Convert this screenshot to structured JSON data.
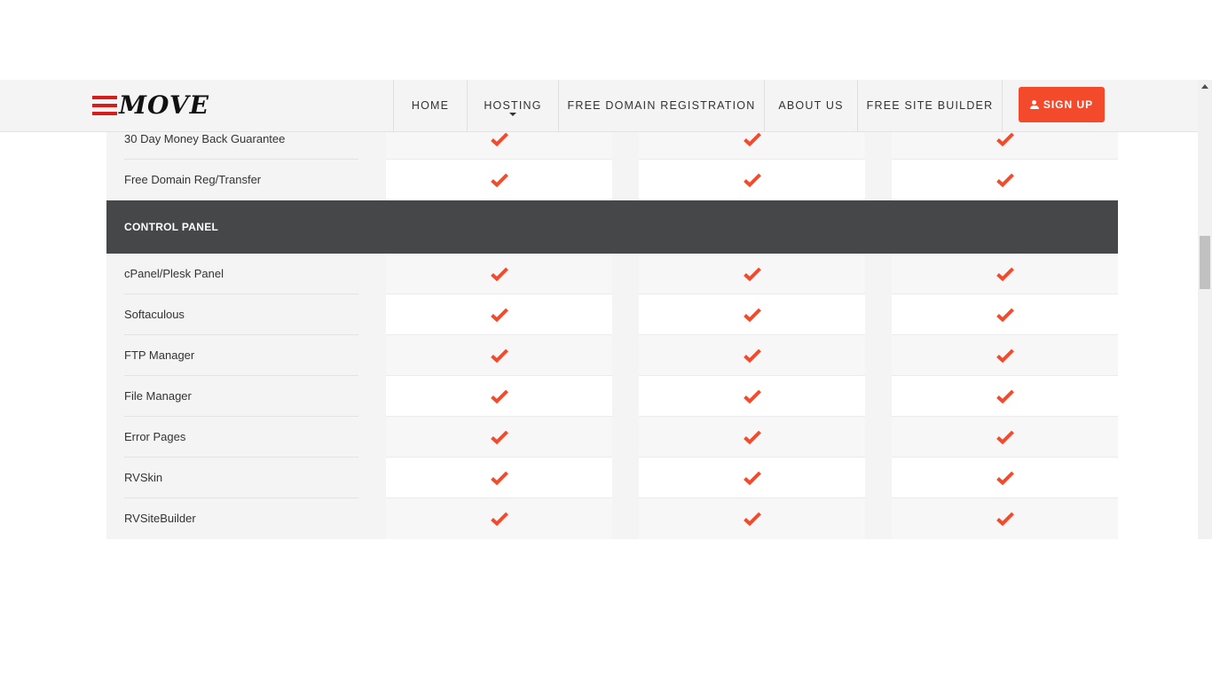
{
  "header": {
    "logo_text": "MOVE",
    "nav": [
      {
        "label": "HOME",
        "has_dropdown": false
      },
      {
        "label": "HOSTING",
        "has_dropdown": true
      },
      {
        "label": "FREE DOMAIN REGISTRATION",
        "has_dropdown": false
      },
      {
        "label": "ABOUT US",
        "has_dropdown": false
      },
      {
        "label": "FREE SITE BUILDER",
        "has_dropdown": false
      }
    ],
    "signup_label": "SIGN UP",
    "signup_icon": "user-icon"
  },
  "colors": {
    "accent": "#f44a2c",
    "logo_red": "#d81b1b",
    "section_header_bg": "#454749",
    "check": "#f44a2c"
  },
  "table": {
    "rows_top": [
      {
        "label": "30 Day Money Back Guarantee",
        "plans": [
          true,
          true,
          true
        ]
      },
      {
        "label": "Free Domain Reg/Transfer",
        "plans": [
          true,
          true,
          true
        ]
      }
    ],
    "section": {
      "title": "CONTROL PANEL",
      "rows": [
        {
          "label": "cPanel/Plesk Panel",
          "plans": [
            true,
            true,
            true
          ]
        },
        {
          "label": "Softaculous",
          "plans": [
            true,
            true,
            true
          ]
        },
        {
          "label": "FTP Manager",
          "plans": [
            true,
            true,
            true
          ]
        },
        {
          "label": "File Manager",
          "plans": [
            true,
            true,
            true
          ]
        },
        {
          "label": "Error Pages",
          "plans": [
            true,
            true,
            true
          ]
        },
        {
          "label": "RVSkin",
          "plans": [
            true,
            true,
            true
          ]
        },
        {
          "label": "RVSiteBuilder",
          "plans": [
            true,
            true,
            true
          ]
        }
      ]
    }
  }
}
